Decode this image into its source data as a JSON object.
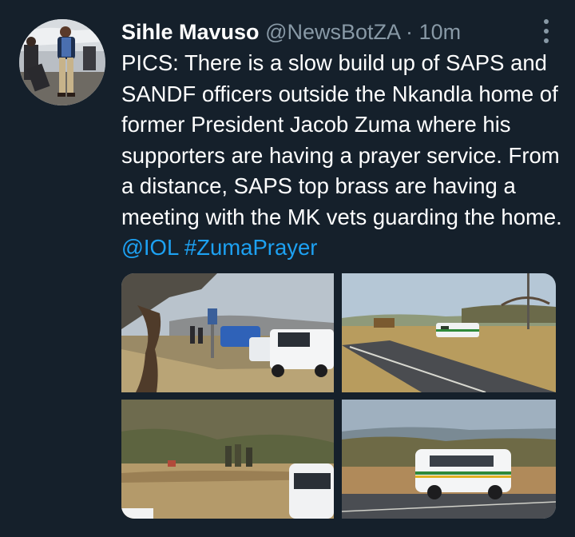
{
  "tweet": {
    "author_name": "Sihle Mavuso",
    "handle": "@NewsBotZA",
    "separator": "·",
    "time": "10m",
    "text": "PICS: There is a slow build up of SAPS and SANDF officers outside the Nkandla home of former President Jacob Zuma where his supporters are having a prayer service. From a distance, SAPS top brass are having a meeting with the MK vets guarding the home.",
    "mention": "@IOL",
    "hashtag": "#ZumaPrayer",
    "more_icon": "more-vertical-icon"
  },
  "colors": {
    "background": "#15202b",
    "text": "#ffffff",
    "secondary": "#8899a6",
    "link": "#1da1f2"
  },
  "media": {
    "count": 4
  }
}
